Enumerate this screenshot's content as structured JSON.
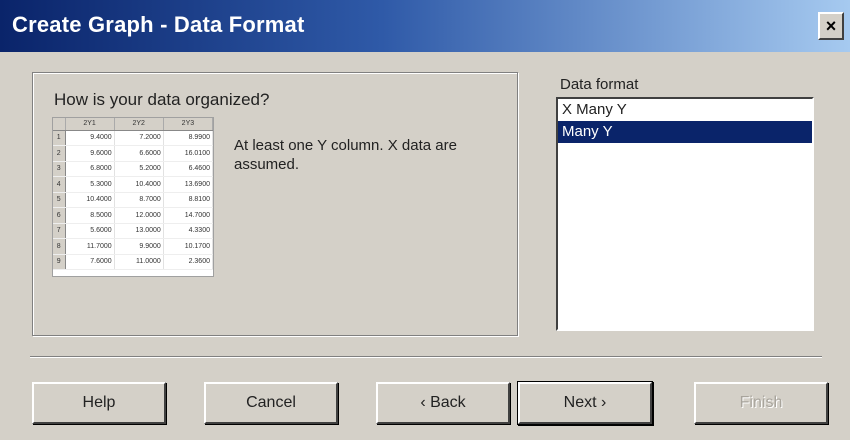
{
  "window": {
    "title": "Create Graph - Data Format",
    "close_glyph": "×"
  },
  "main": {
    "question": "How is your data organized?",
    "description": "At least one Y column. X data are assumed.",
    "preview": {
      "headers": [
        "",
        "2Y1",
        "2Y2",
        "2Y3"
      ],
      "rows": [
        [
          "1",
          "9.4000",
          "7.2000",
          "8.9900"
        ],
        [
          "2",
          "9.6000",
          "6.6000",
          "16.0100"
        ],
        [
          "3",
          "6.8000",
          "5.2000",
          "6.4600"
        ],
        [
          "4",
          "5.3000",
          "10.4000",
          "13.6900"
        ],
        [
          "5",
          "10.4000",
          "8.7000",
          "8.8100"
        ],
        [
          "6",
          "8.5000",
          "12.0000",
          "14.7000"
        ],
        [
          "7",
          "5.6000",
          "13.0000",
          "4.3300"
        ],
        [
          "8",
          "11.7000",
          "9.9000",
          "10.1700"
        ],
        [
          "9",
          "7.6000",
          "11.0000",
          "2.3600"
        ]
      ]
    }
  },
  "format": {
    "label": "Data format",
    "options": [
      "X Many Y",
      "Many Y"
    ],
    "selected_index": 1
  },
  "buttons": {
    "help": "Help",
    "cancel": "Cancel",
    "back": "‹ Back",
    "next": "Next ›",
    "finish": "Finish"
  },
  "colors": {
    "selection": "#0a246a",
    "dialog_face": "#d4d0c8"
  }
}
